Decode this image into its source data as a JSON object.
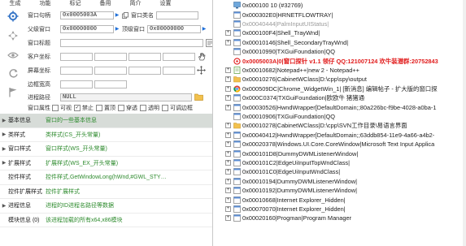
{
  "menu": [
    "生成",
    "功能",
    "标记",
    "备用",
    "简介",
    "设置"
  ],
  "props": {
    "window_handle_label": "窗口句柄",
    "window_handle_value": "0x0005003A",
    "window_class_label": "窗口类名",
    "parent_label": "父级窗口",
    "parent_value": "0x00000000",
    "top_label": "顶级窗口",
    "top_value": "0x00000000",
    "title_label": "窗口标题",
    "client_label": "客户坐标",
    "screen_label": "屏幕坐标",
    "border_label": "边框宽高",
    "process_label": "进程路径",
    "process_value": "NULL",
    "attr_label": "窗口属性",
    "checks": [
      "可视",
      "禁止",
      "置顶",
      "穿透",
      "透明",
      "可调边框"
    ]
  },
  "info_rows": [
    {
      "label": "基本信息",
      "value": "窗口的一些基本信息",
      "expander": "▶"
    },
    {
      "label": "类样式",
      "value": "类样式(CS_开头常量)",
      "expander": "▶"
    },
    {
      "label": "窗口样式",
      "value": "窗口样式(WS_开头常量)",
      "expander": "▶"
    },
    {
      "label": "扩展样式",
      "value": "扩展样式(WS_EX_开头常量)",
      "expander": "▶"
    },
    {
      "label": "控件样式",
      "value": "控件样式,GetWindowLong(hWnd,#GWL_STY…",
      "expander": ""
    },
    {
      "label": "控件扩展样式",
      "value": "控件扩展样式",
      "expander": ""
    },
    {
      "label": "进程信息",
      "value": "进程的ID进程名路径等数据",
      "expander": "▶"
    },
    {
      "label": "模块信息 (0)",
      "value": "该进程加载的所有x64,x86模块",
      "expander": ""
    }
  ],
  "tree": [
    {
      "box": "",
      "text": "0x000100 10 (#32769)",
      "style": "normal",
      "icon": "desktop"
    },
    {
      "box": "",
      "text": "0x000302E0|HRNETFLOWTRAY|",
      "style": "normal",
      "icon": "window"
    },
    {
      "box": "",
      "text": "0x00040444|PalmInputUIStatus|",
      "style": "gray",
      "icon": "window"
    },
    {
      "box": "+",
      "text": "0x000100F4|Shell_TrayWnd|",
      "style": "normal",
      "icon": "window"
    },
    {
      "box": "+",
      "text": "0x00010146|Shell_SecondaryTrayWnd|",
      "style": "normal",
      "icon": "window"
    },
    {
      "box": "",
      "text": "0x00010990|TXGuiFoundation|QQ",
      "style": "normal",
      "icon": "window"
    },
    {
      "box": "",
      "text": "0x0005003A|0|窗口探针 v1.1 领仔  QQ:121007124  欢牛装潜群:20752843",
      "style": "red",
      "icon": "probe"
    },
    {
      "box": "+",
      "text": "0x00010682|Notepad++|new 2 - Notepad++",
      "style": "normal",
      "icon": "notepad"
    },
    {
      "box": "+",
      "text": "0x00010276|CabinetWClass|D:\\cpp\\spy\\output",
      "style": "normal",
      "icon": "folder"
    },
    {
      "box": "+",
      "text": "0x000509DC|Chrome_WidgetWin_1| [新消息] 编辑帖子 - 扩大版的窗口探",
      "style": "normal",
      "icon": "chrome"
    },
    {
      "box": "+",
      "text": "0x000C0374|TXGuiFoundation|欧欧牛 猪猪通",
      "style": "normal",
      "icon": "window"
    },
    {
      "box": "+",
      "text": "0x00030526|HwndWrapper[DefaultDomain;;80a226bc-f9be-4028-a0ba-1",
      "style": "normal",
      "icon": "window"
    },
    {
      "box": "",
      "text": "0x00010906|TXGuiFoundation|QQ",
      "style": "normal",
      "icon": "window"
    },
    {
      "box": "+",
      "text": "0x00010278|CabinetWClass|D:\\cpp\\SVN工作目录\\易语言界面",
      "style": "normal",
      "icon": "folder"
    },
    {
      "box": "+",
      "text": "0x00040412|HwndWrapper[DefaultDomain;;63ddb854-11e9-4a66-a4b2-",
      "style": "normal",
      "icon": "window"
    },
    {
      "box": "+",
      "text": "0x00020378|Windows.UI.Core.CoreWindow|Microsoft Text Input Applica",
      "style": "normal",
      "icon": "window"
    },
    {
      "box": "+",
      "text": "0x000101D8|DummyDWMListenerWindow|",
      "style": "normal",
      "icon": "window"
    },
    {
      "box": "+",
      "text": "0x000101C2|EdgeUiInputTopWndClass|",
      "style": "normal",
      "icon": "window"
    },
    {
      "box": "+",
      "text": "0x000101C0|EdgeUiInputWndClass|",
      "style": "normal",
      "icon": "window"
    },
    {
      "box": "+",
      "text": "0x00010194|DummyDWMListenerWindow|",
      "style": "normal",
      "icon": "window"
    },
    {
      "box": "+",
      "text": "0x00010192|DummyDWMListenerWindow|",
      "style": "normal",
      "icon": "window"
    },
    {
      "box": "+",
      "text": "0x00010668|Internet Explorer_Hidden|",
      "style": "normal",
      "icon": "window"
    },
    {
      "box": "+",
      "text": "0x00070070|Internet Explorer_Hidden|",
      "style": "normal",
      "icon": "window"
    },
    {
      "box": "+",
      "text": "0x00020160|Progman|Program Manager",
      "style": "normal",
      "icon": "window"
    }
  ],
  "colors": {
    "accent_green": "#2e8b2e",
    "highlight_red": "#e11b1b",
    "link_blue": "#1e6fd9"
  }
}
